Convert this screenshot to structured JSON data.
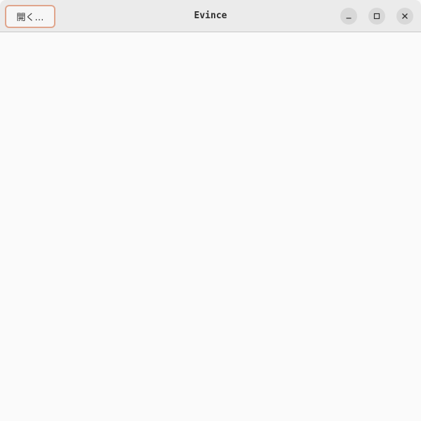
{
  "window": {
    "title": "Evince"
  },
  "headerbar": {
    "open_button_label": "開く…",
    "controls": [
      {
        "name": "minimize",
        "icon": "minimize-icon"
      },
      {
        "name": "maximize",
        "icon": "maximize-icon"
      },
      {
        "name": "close",
        "icon": "close-icon"
      }
    ]
  },
  "colors": {
    "headerbar_bg": "#ebebeb",
    "content_bg": "#fafafa",
    "focus_ring": "#e0a58c",
    "control_bg": "#d8d8d8"
  }
}
